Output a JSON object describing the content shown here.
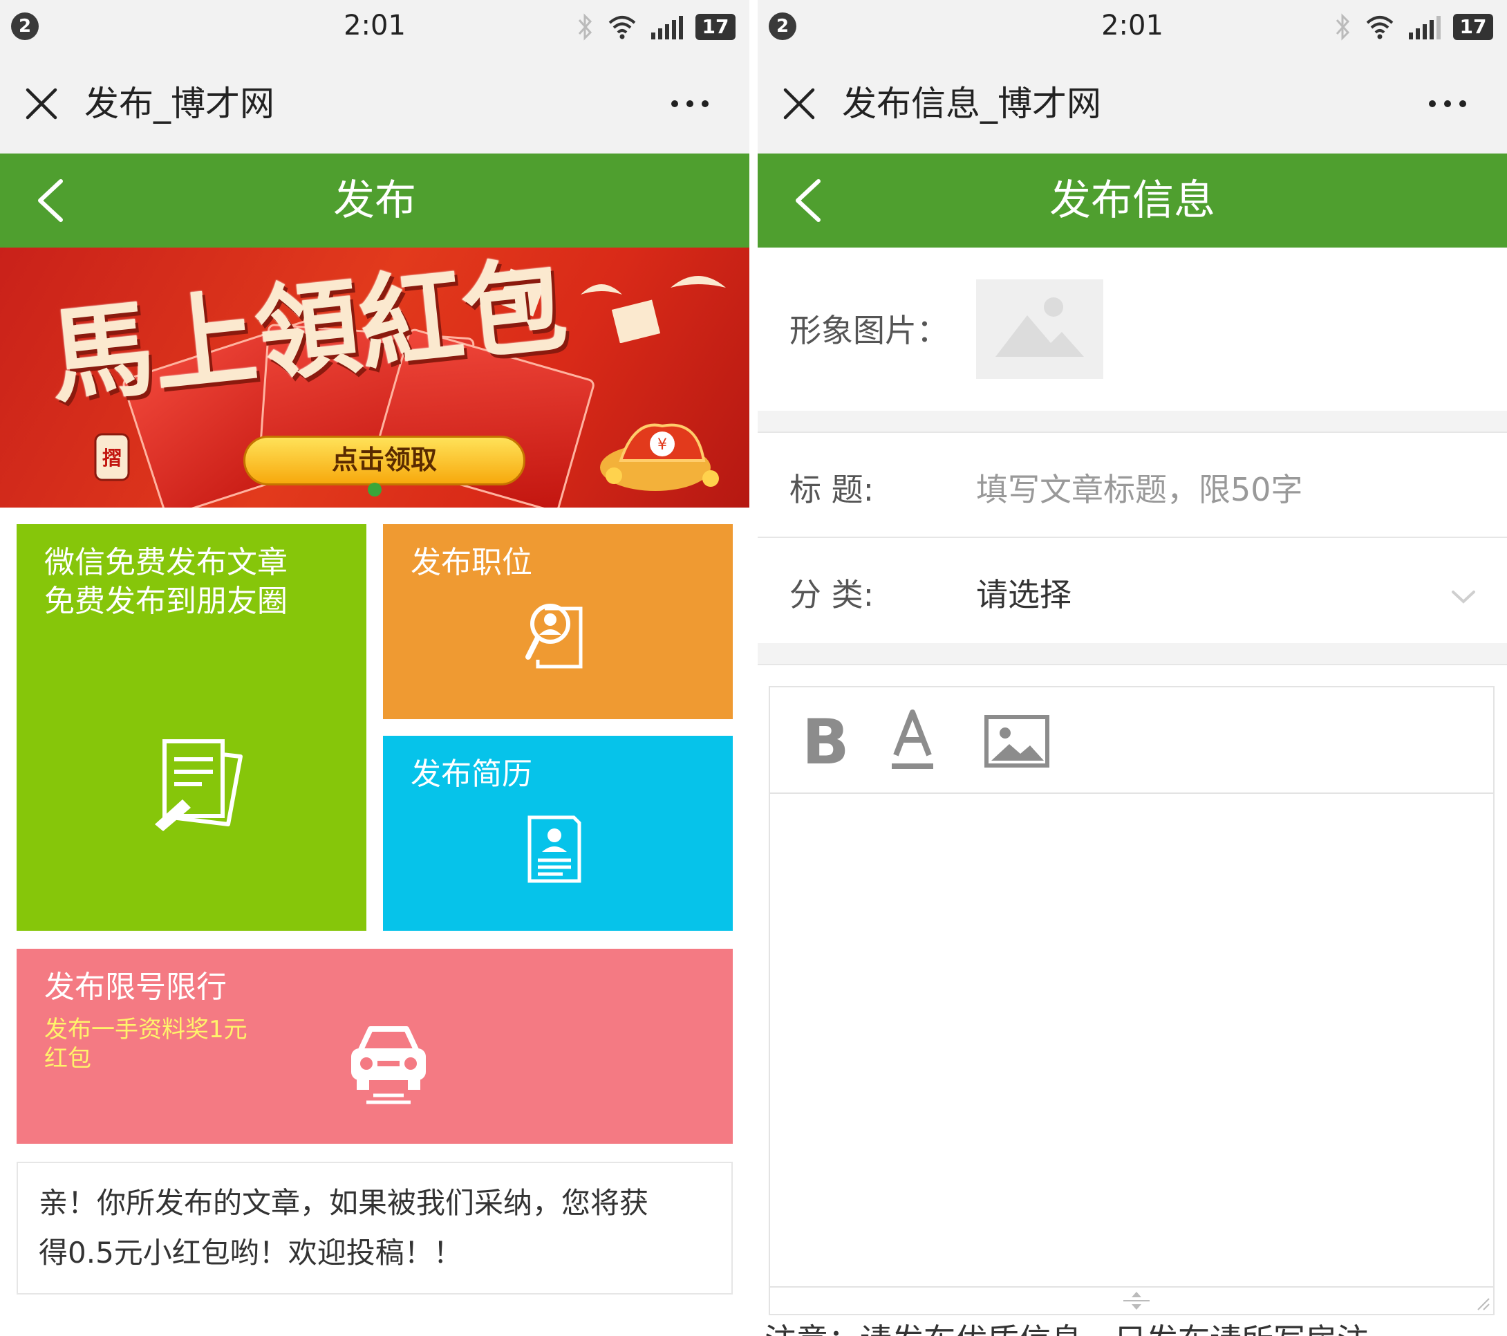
{
  "left": {
    "status": {
      "notif_count": "2",
      "time": "2:01",
      "battery": "17"
    },
    "wx": {
      "title": "发布_博才网"
    },
    "header": {
      "title": "发布"
    },
    "banner": {
      "title": "馬上領紅包",
      "button": "点击领取",
      "stamp": "摺",
      "red_envelope_mark": "¥"
    },
    "tiles": {
      "wechat": {
        "line1": "微信免费发布文章",
        "line2": "免费发布到朋友圈"
      },
      "job": {
        "title": "发布职位"
      },
      "resume": {
        "title": "发布简历"
      },
      "traffic": {
        "title": "发布限号限行",
        "sub1": "发布一手资料奖1元",
        "sub2": "红包"
      }
    },
    "notice": {
      "line1": "亲！你所发布的文章，如果被我们采纳，您将获",
      "line2": "得0.5元小红包哟！欢迎投稿！！"
    }
  },
  "right": {
    "status": {
      "notif_count": "2",
      "time": "2:01",
      "battery": "17"
    },
    "wx": {
      "title": "发布信息_博才网"
    },
    "header": {
      "title": "发布信息"
    },
    "form": {
      "image_label": "形象图片：",
      "title_label": "标 题:",
      "title_placeholder": "填写文章标题，限50字",
      "category_label": "分 类:",
      "category_value": "请选择"
    },
    "editor": {
      "bold_glyph": "B"
    },
    "footer_cut": "注意：请发布优质信息，只发布请所写房注"
  },
  "colors": {
    "green": "#4f9f2f",
    "lime": "#86c60a",
    "orange": "#ef9a32",
    "cyan": "#06c3ea",
    "pink": "#f47a83",
    "banner_red": "#d92a18"
  },
  "icons": [
    "notification-badge",
    "bluetooth-icon",
    "wifi-icon",
    "signal-icon",
    "battery-icon",
    "close-icon",
    "more-icon",
    "back-icon",
    "article-edit-icon",
    "job-search-icon",
    "resume-icon",
    "car-icon",
    "image-placeholder-icon",
    "chevron-down-icon",
    "bold-icon",
    "font-color-icon",
    "insert-image-icon",
    "resize-icon"
  ]
}
